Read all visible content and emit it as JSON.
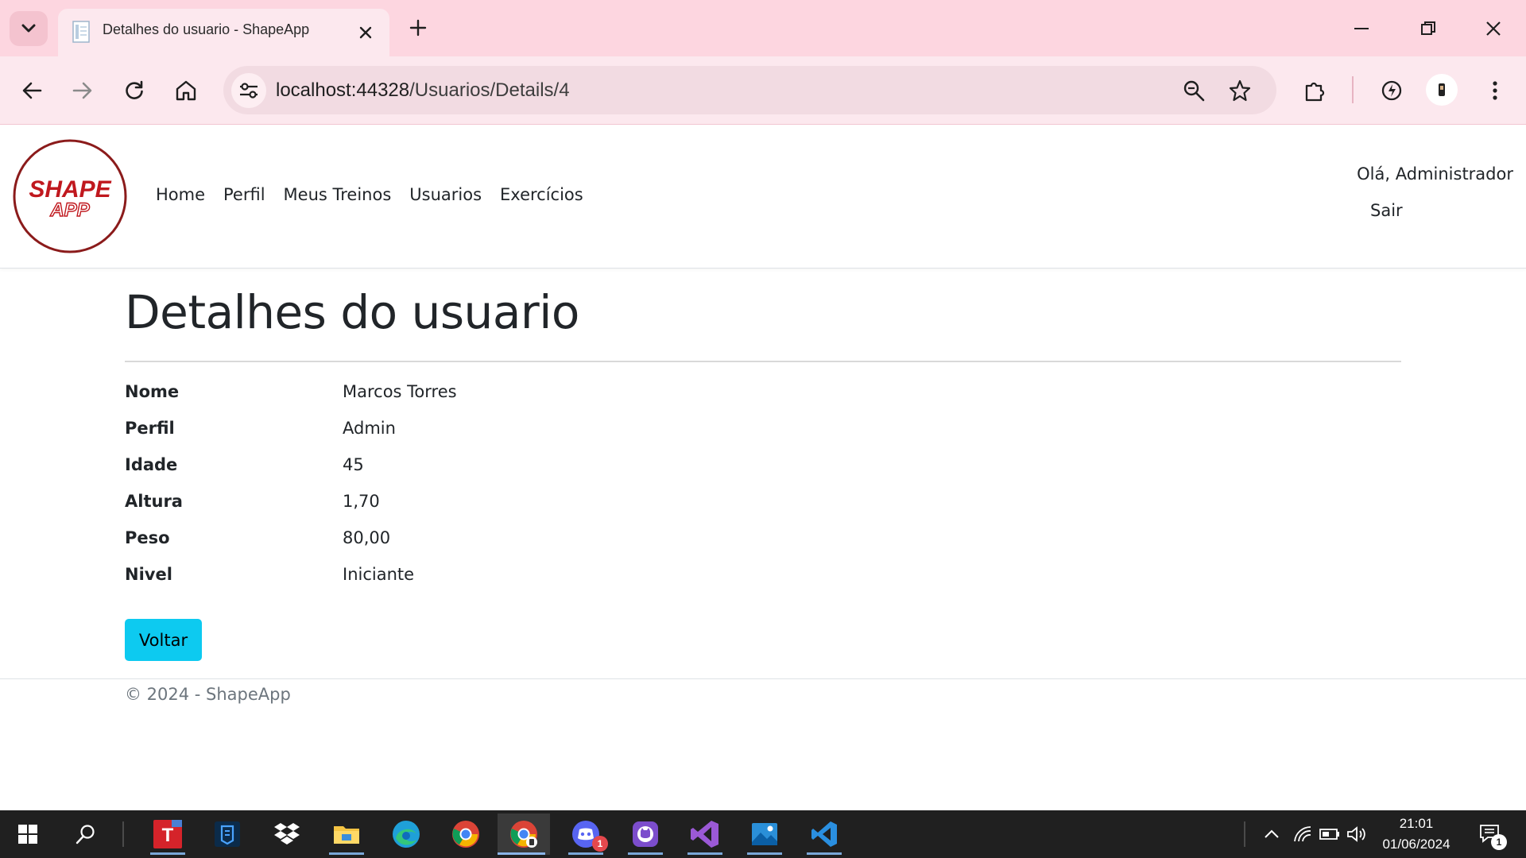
{
  "browser": {
    "tab_title": "Detalhes do usuario - ShapeApp",
    "url_host": "localhost:44328",
    "url_path": "/Usuarios/Details/4",
    "accent_color": "#fdd6e0"
  },
  "navbar": {
    "logo_text_top": "SHAPE",
    "logo_text_bottom": "APP",
    "links": [
      "Home",
      "Perfil",
      "Meus Treinos",
      "Usuarios",
      "Exercícios"
    ],
    "greeting": "Olá, Administrador",
    "logout_label": "Sair"
  },
  "main": {
    "title": "Detalhes do usuario",
    "details": [
      {
        "label": "Nome",
        "value": "Marcos Torres"
      },
      {
        "label": "Perfil",
        "value": "Admin"
      },
      {
        "label": "Idade",
        "value": "45"
      },
      {
        "label": "Altura",
        "value": "1,70"
      },
      {
        "label": "Peso",
        "value": "80,00"
      },
      {
        "label": "Nivel",
        "value": "Iniciante"
      }
    ],
    "back_button": "Voltar",
    "button_color": "#0dcaf0"
  },
  "footer": {
    "text": "© 2024 - ShapeApp"
  },
  "taskbar": {
    "time": "21:01",
    "date": "01/06/2024",
    "discord_badge": "1",
    "notification_badge": "1"
  }
}
